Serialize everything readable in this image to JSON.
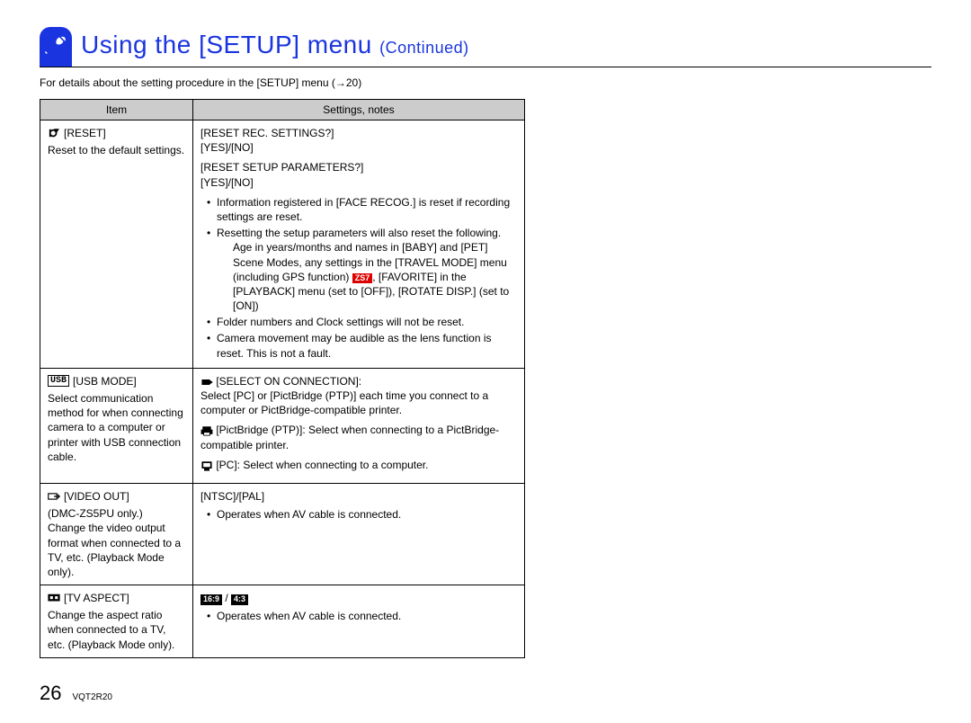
{
  "title_main": "Using the [SETUP] menu ",
  "title_sub": "(Continued)",
  "intro": "For details about the setting procedure in the [SETUP] menu (→20)",
  "header_item": "Item",
  "header_notes": "Settings, notes",
  "row1": {
    "label": "[RESET]",
    "desc": "Reset to the default settings.",
    "set1_title": "[RESET REC. SETTINGS?]",
    "set1_opts": "[YES]/[NO]",
    "set2_title": "[RESET SETUP PARAMETERS?]",
    "set2_opts": "[YES]/[NO]",
    "n1": "Information registered in [FACE RECOG.] is reset if recording settings are reset.",
    "n2a": "Resetting the setup parameters will also reset the following.",
    "n2b": "Age in years/months and names in [BABY] and [PET] Scene Modes, any settings in the [TRAVEL MODE] menu (including GPS function) ",
    "n2b_badge": "ZS7",
    "n2c": ", [FAVORITE] in the [PLAYBACK] menu (set to [OFF]), [ROTATE DISP.] (set to [ON])",
    "n3": "Folder numbers and Clock settings will not be reset.",
    "n4": "Camera movement may be audible as the lens function is reset. This is not a fault."
  },
  "row2": {
    "icon": "USB",
    "label": "[USB MODE]",
    "desc": "Select communication method for when connecting camera to a computer or printer with USB connection cable.",
    "o1_label": "[SELECT ON CONNECTION]:",
    "o1_text": "Select [PC] or [PictBridge (PTP)] each time you connect to a computer or PictBridge-compatible printer.",
    "o2_label": "[PictBridge (PTP)]:",
    "o2_text": " Select when connecting to a PictBridge-compatible printer.",
    "o3_label": "[PC]:",
    "o3_text": " Select when connecting to a computer."
  },
  "row3": {
    "label": "[VIDEO OUT]",
    "desc": "(DMC-ZS5PU only.)\nChange the video output format when connected to a TV, etc. (Playback Mode only).",
    "opts": "[NTSC]/[PAL]",
    "n1": "Operates when AV cable is connected."
  },
  "row4": {
    "label": "[TV ASPECT]",
    "desc": "Change the aspect ratio when connected to a TV, etc. (Playback Mode only).",
    "opt1": "16:9",
    "opt_sep": " / ",
    "opt2": "4:3",
    "n1": "Operates when AV cable is connected."
  },
  "footer": {
    "page": "26",
    "code": "VQT2R20"
  }
}
